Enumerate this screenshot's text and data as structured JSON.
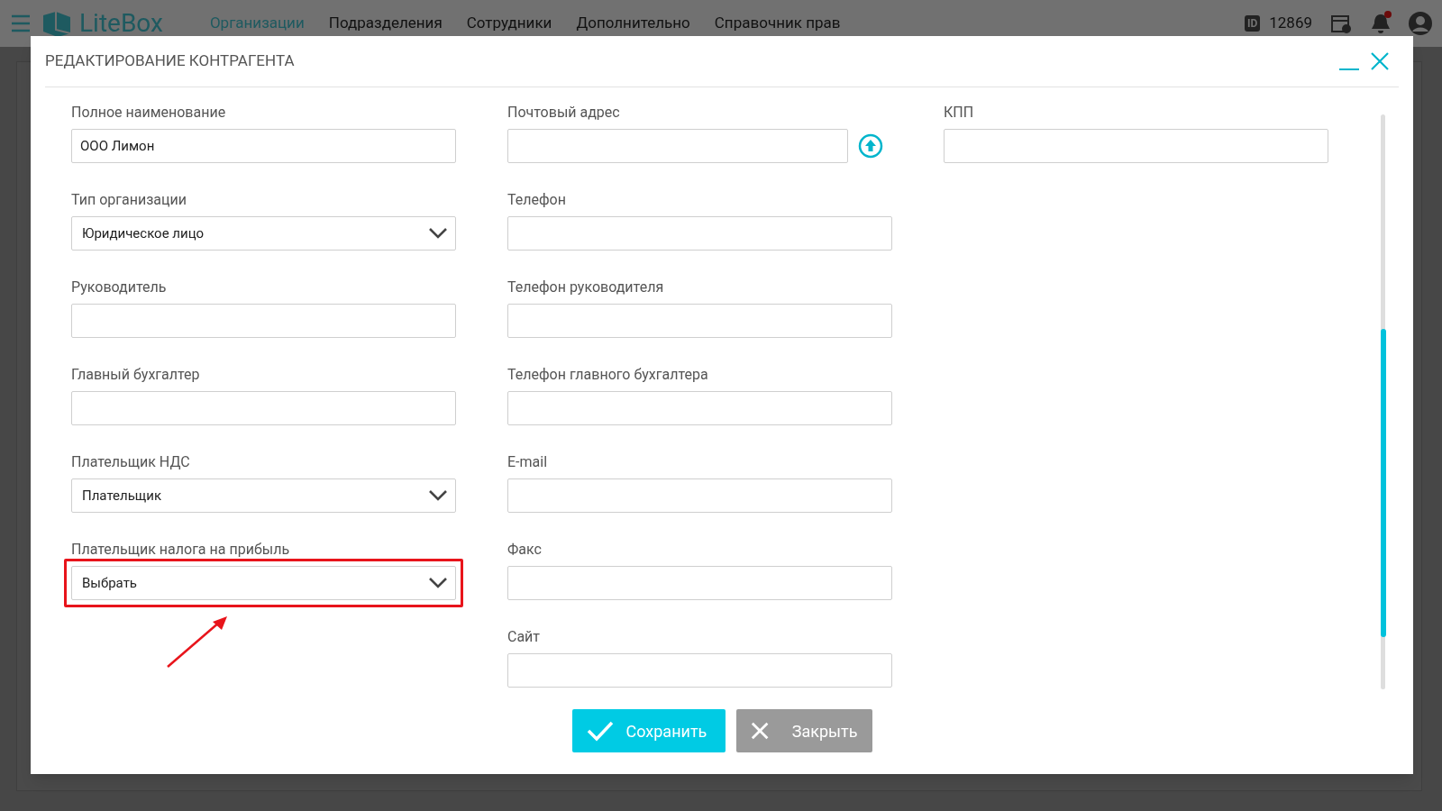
{
  "app_bar": {
    "logo": "LiteBox",
    "menu": [
      {
        "label": "Организации",
        "selected": true
      },
      {
        "label": "Подразделения",
        "selected": false
      },
      {
        "label": "Сотрудники",
        "selected": false
      },
      {
        "label": "Дополнительно",
        "selected": false
      },
      {
        "label": "Справочник прав",
        "selected": false
      }
    ],
    "id_badge": "ID",
    "user_id": "12869",
    "notifications_unread": true
  },
  "dialog": {
    "title": "РЕДАКТИРОВАНИЕ КОНТРАГЕНТА",
    "columns": [
      [
        {
          "kind": "input",
          "label": "Полное наименование",
          "value": "ООО Лимон",
          "highlighted": false
        },
        {
          "kind": "select",
          "label": "Тип организации",
          "value": "Юридическое лицо",
          "highlighted": false
        },
        {
          "kind": "input",
          "label": "Руководитель",
          "highlighted": false
        },
        {
          "kind": "input",
          "label": "Главный бухгалтер",
          "highlighted": false
        },
        {
          "kind": "select",
          "label": "Плательщик НДС",
          "value": "Плательщик",
          "highlighted": false
        },
        {
          "kind": "select",
          "label": "Плательщик налога на прибыль",
          "value": "Выбрать",
          "highlighted": true
        }
      ],
      [
        {
          "kind": "input_with_button",
          "label": "Почтовый адрес",
          "highlighted": false
        },
        {
          "kind": "input",
          "label": "Телефон",
          "highlighted": false
        },
        {
          "kind": "input",
          "label": "Телефон руководителя",
          "highlighted": false
        },
        {
          "kind": "input",
          "label": "Телефон главного бухгалтера",
          "highlighted": false
        },
        {
          "kind": "input",
          "label": "E-mail",
          "highlighted": false
        },
        {
          "kind": "input",
          "label": "Факс",
          "highlighted": false
        },
        {
          "kind": "input",
          "label": "Сайт",
          "highlighted": false
        }
      ],
      [
        {
          "kind": "input",
          "label": "КПП",
          "highlighted": false
        }
      ]
    ],
    "buttons": [
      {
        "kind": "save",
        "label": "Сохранить"
      },
      {
        "kind": "close",
        "label": "Закрыть"
      }
    ]
  }
}
